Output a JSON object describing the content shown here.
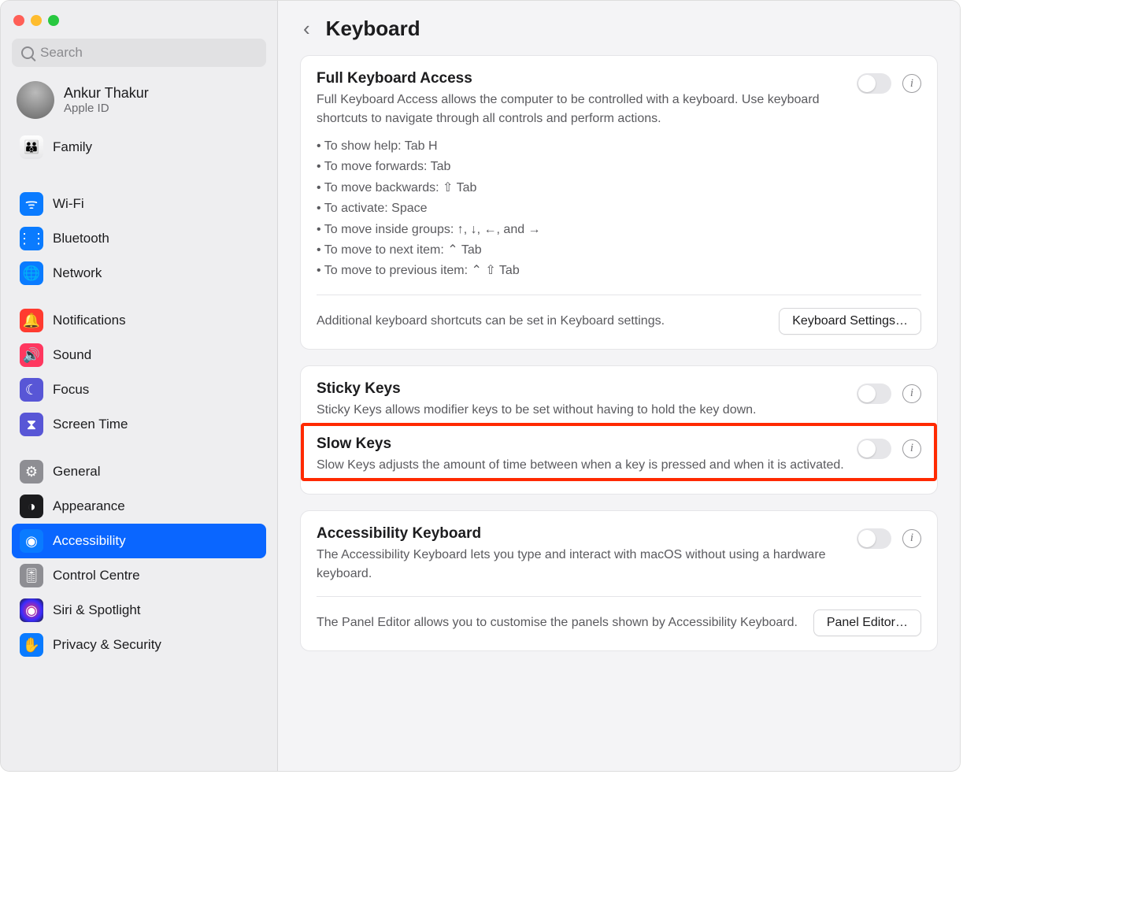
{
  "sidebar": {
    "search_placeholder": "Search",
    "account": {
      "name": "Ankur Thakur",
      "sub": "Apple ID"
    },
    "family_label": "Family",
    "groups": [
      [
        {
          "id": "wifi",
          "label": "Wi-Fi",
          "glyph": "ᯤ"
        },
        {
          "id": "bluetooth",
          "label": "Bluetooth",
          "glyph": "⋮⋮"
        },
        {
          "id": "network",
          "label": "Network",
          "glyph": "🌐"
        }
      ],
      [
        {
          "id": "notifications",
          "label": "Notifications",
          "glyph": "🔔"
        },
        {
          "id": "sound",
          "label": "Sound",
          "glyph": "🔊"
        },
        {
          "id": "focus",
          "label": "Focus",
          "glyph": "☾"
        },
        {
          "id": "screentime",
          "label": "Screen Time",
          "glyph": "⧗"
        }
      ],
      [
        {
          "id": "general",
          "label": "General",
          "glyph": "⚙"
        },
        {
          "id": "appearance",
          "label": "Appearance",
          "glyph": "◑"
        },
        {
          "id": "accessibility",
          "label": "Accessibility",
          "glyph": "◉",
          "selected": true
        },
        {
          "id": "controlcentre",
          "label": "Control Centre",
          "glyph": "🎚"
        },
        {
          "id": "siri",
          "label": "Siri & Spotlight",
          "glyph": "◉"
        },
        {
          "id": "privacy",
          "label": "Privacy & Security",
          "glyph": "✋"
        }
      ]
    ]
  },
  "content": {
    "title": "Keyboard",
    "card1": {
      "title": "Full Keyboard Access",
      "desc": "Full Keyboard Access allows the computer to be controlled with a keyboard. Use keyboard shortcuts to navigate through all controls and perform actions.",
      "bullets": [
        "To show help: Tab H",
        "To move forwards: Tab",
        "To move backwards: ⇧ Tab",
        "To activate: Space",
        "To move inside groups: ↑, ↓, ←, and →",
        "To move to next item: ⌃ Tab",
        "To move to previous item: ⌃ ⇧ Tab"
      ],
      "footer_text": "Additional keyboard shortcuts can be set in Keyboard settings.",
      "footer_button": "Keyboard Settings…"
    },
    "card2": {
      "sticky_title": "Sticky Keys",
      "sticky_desc": "Sticky Keys allows modifier keys to be set without having to hold the key down.",
      "slow_title": "Slow Keys",
      "slow_desc": "Slow Keys adjusts the amount of time between when a key is pressed and when it is activated."
    },
    "card3": {
      "title": "Accessibility Keyboard",
      "desc": "The Accessibility Keyboard lets you type and interact with macOS without using a hardware keyboard.",
      "footer_text": "The Panel Editor allows you to customise the panels shown by Accessibility Keyboard.",
      "footer_button": "Panel Editor…"
    }
  }
}
